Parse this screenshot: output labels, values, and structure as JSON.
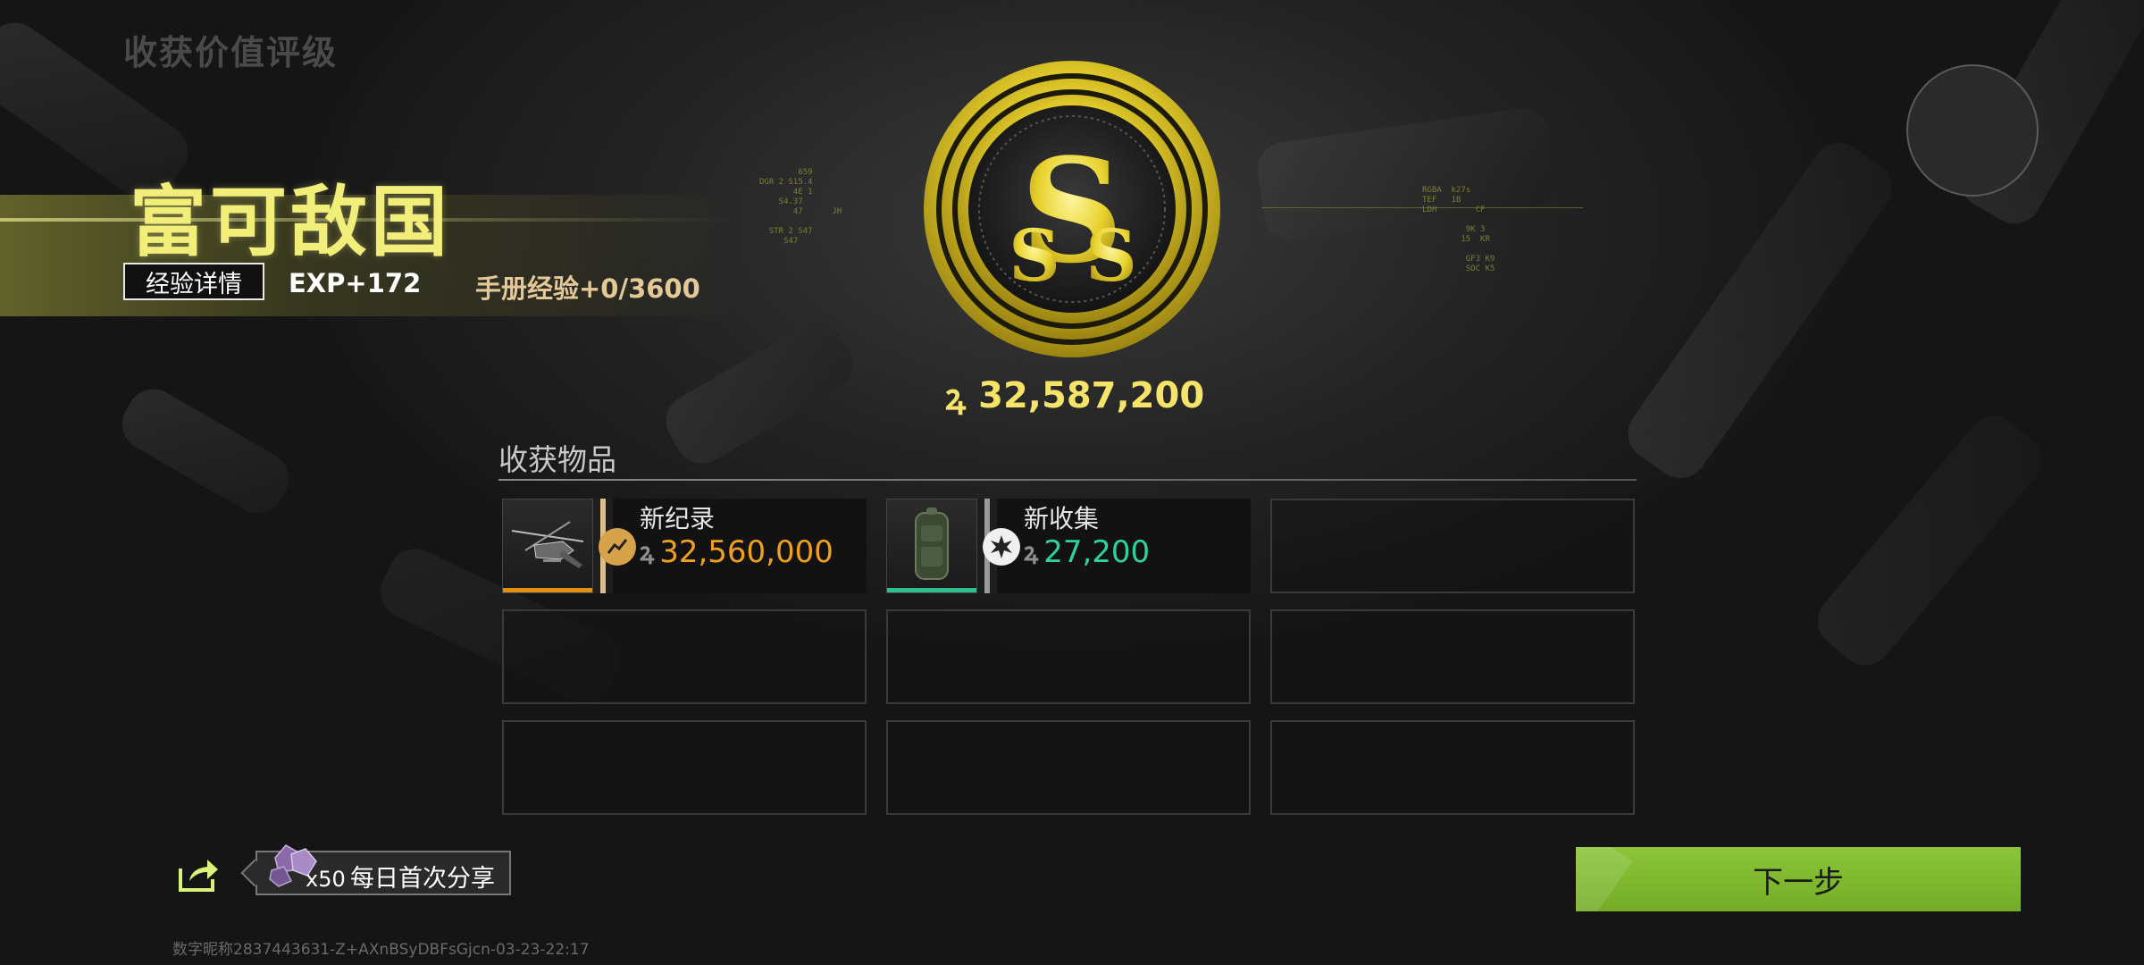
{
  "header": {
    "page_title": "收获价值评级"
  },
  "rating": {
    "title": "富可敌国",
    "exp_details_label": "经验详情",
    "exp_gain": "EXP+172",
    "handbook_exp": "手册经验+0/3600",
    "badge_grade": "S"
  },
  "total": {
    "currency_icon": "currency-koen-icon",
    "value": "32,587,200"
  },
  "harvest": {
    "section_title": "收获物品",
    "items": [
      {
        "tag": "新纪录",
        "value": "32,560,000",
        "icon": "helicopter-icon",
        "badge_icon": "trend-up-icon",
        "value_color": "#f0a020",
        "rarity_color": "#e09010"
      },
      {
        "tag": "新收集",
        "value": "27,200",
        "icon": "backpack-icon",
        "badge_icon": "starburst-icon",
        "value_color": "#2ed29a",
        "rarity_color": "#2fbf8c"
      }
    ],
    "empty_slot_count": 7
  },
  "share": {
    "reward_count": "x50",
    "label": "每日首次分享",
    "icon": "share-icon",
    "reward_icon": "gem-icon"
  },
  "actions": {
    "next_label": "下一步"
  },
  "footer": {
    "player_id": "数字昵称2837443631-Z+AXnBSyDBFsGjcn-03-23-22:17"
  },
  "colors": {
    "accent_yellow": "#f2ee7a",
    "gold": "#f5e36a",
    "next_button": "#7cb42c"
  }
}
